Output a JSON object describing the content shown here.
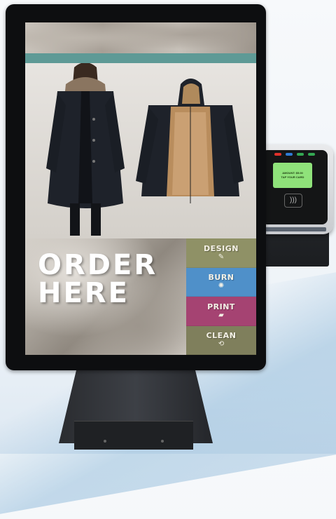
{
  "kiosk": {
    "screen": {
      "headline": "ORDER\nHERE",
      "menu": [
        {
          "label": "DESIGN",
          "icon": "pencil-icon",
          "glyph": "✎",
          "color": "#8f9166"
        },
        {
          "label": "BURN",
          "icon": "flame-icon",
          "glyph": "✺",
          "color": "#4f90c9"
        },
        {
          "label": "PRINT",
          "icon": "print-icon",
          "glyph": "▰",
          "color": "#a54372"
        },
        {
          "label": "CLEAN",
          "icon": "refresh-icon",
          "glyph": "⟲",
          "color": "#7f7f5c"
        }
      ],
      "teal_color": "#5e9a96"
    },
    "card_reader": {
      "screen_line1": "AMOUNT: $5.00",
      "screen_line2": "TAP YOUR CARD",
      "contactless_icon": "contactless-icon",
      "led_colors": [
        "#e0302b",
        "#2e7bd6",
        "#34a853",
        "#34a853"
      ]
    }
  }
}
